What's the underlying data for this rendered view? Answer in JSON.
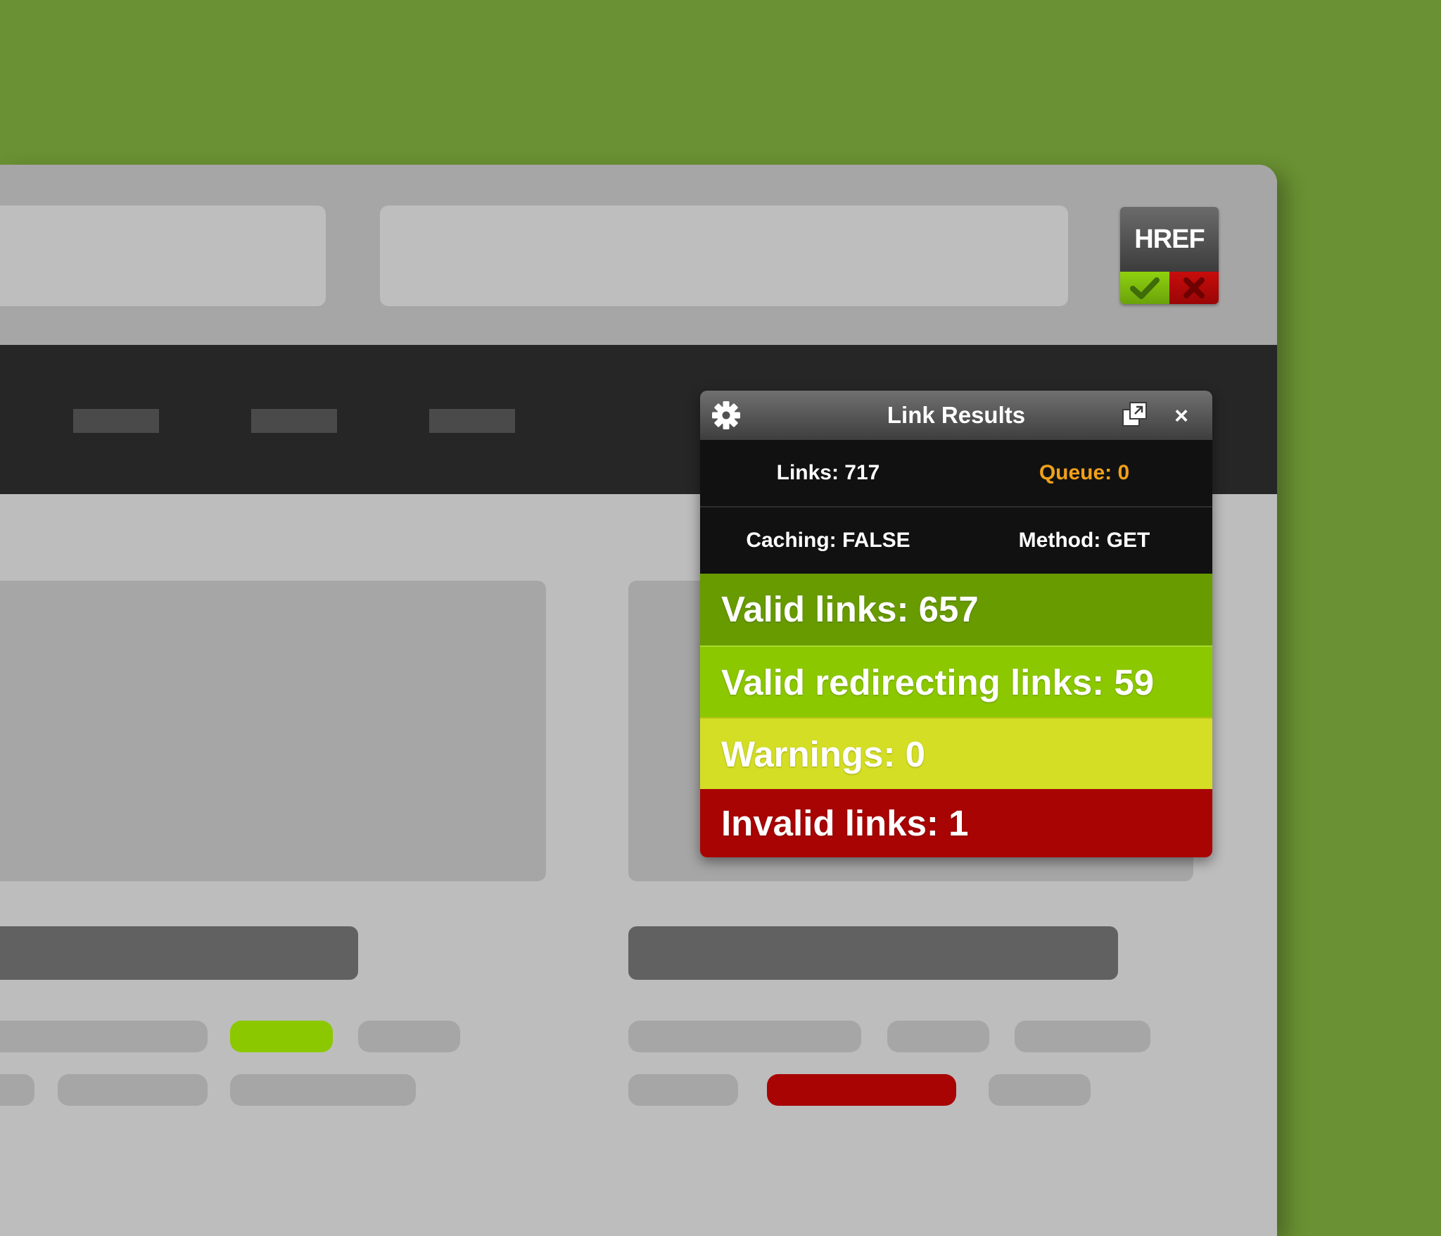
{
  "extension_button": {
    "label": "HREF",
    "ok_icon": "checkmark-icon",
    "error_icon": "x-icon",
    "ok_color": "#7bbf0e",
    "error_color": "#b00808"
  },
  "popup": {
    "title": "Link Results",
    "icons": [
      "gear-icon",
      "popout-icon",
      "close-icon"
    ],
    "close_label": "×",
    "stats": {
      "links": "Links: 717",
      "queue": "Queue: 0",
      "caching": "Caching: FALSE",
      "method": "Method: GET"
    },
    "summary": {
      "valid": "Valid links: 657",
      "redirecting": "Valid redirecting links: 59",
      "warnings": "Warnings: 0",
      "invalid": "Invalid links: 1"
    },
    "colors": {
      "queue_text": "#f0a01a",
      "valid": "#689b00",
      "redirecting": "#8cc800",
      "warnings": "#d4de24",
      "invalid": "#a80404"
    }
  },
  "page_mockup": {
    "highlight_green": "#8cc800",
    "highlight_red": "#a80404"
  }
}
